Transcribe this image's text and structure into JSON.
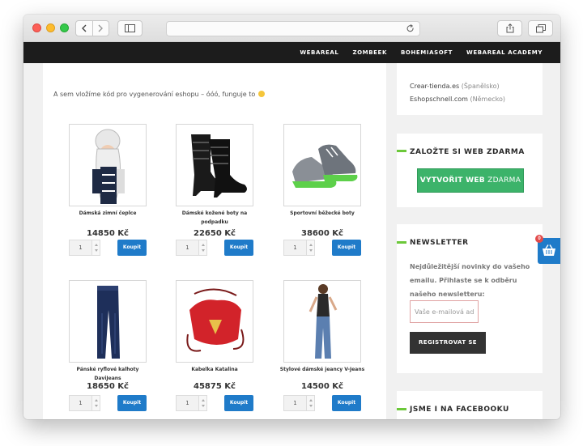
{
  "nav": {
    "links": [
      "WEBAREAL",
      "ZOMBEEK",
      "BOHEMIASOFT",
      "WEBAREAL ACADEMY"
    ]
  },
  "intro": "A sem vložíme kód pro vygenerování eshopu – óóó, funguje to",
  "products": [
    {
      "name": "Dámská zimní čeplce",
      "price": "14850 Kč",
      "qty": "1",
      "buy": "Koupit"
    },
    {
      "name": "Dámské kožené boty na podpadku",
      "price": "22650 Kč",
      "qty": "1",
      "buy": "Koupit"
    },
    {
      "name": "Sportovní běžecké boty",
      "price": "38600 Kč",
      "qty": "1",
      "buy": "Koupit"
    },
    {
      "name": "Pánské ryflové kalhoty DaviJeans",
      "price": "18650 Kč",
      "qty": "1",
      "buy": "Koupit"
    },
    {
      "name": "Kabelka Katalina",
      "price": "45875 Kč",
      "qty": "1",
      "buy": "Koupit"
    },
    {
      "name": "Stylové dámské jeancy V-Jeans",
      "price": "14500 Kč",
      "qty": "1",
      "buy": "Koupit"
    }
  ],
  "sidebar": {
    "links": [
      {
        "text": "Crear-tienda.es",
        "note": "(Španělsko)"
      },
      {
        "text": "Eshopschnell.com",
        "note": "(Německo)"
      }
    ],
    "web_title": "ZALOŽTE SI WEB ZDARMA",
    "create_bold": "VYTVOŘIT WEB",
    "create_rest": "ZDARMA",
    "newsletter_title": "NEWSLETTER",
    "newsletter_text": "Nejdůležitější novinky do vašeho emailu. Přihlaste se k odběru našeho newsletteru:",
    "email_placeholder": "Vaše e-mailová adresa",
    "register": "REGISTROVAT SE",
    "facebook_title": "JSME I NA FACEBOOKU"
  },
  "cart": {
    "count": "0"
  },
  "colors": {
    "accent_blue": "#1f7bc9",
    "accent_green": "#6cc83a",
    "cta_green": "#3cb36a",
    "navbar": "#1c1c1c"
  }
}
